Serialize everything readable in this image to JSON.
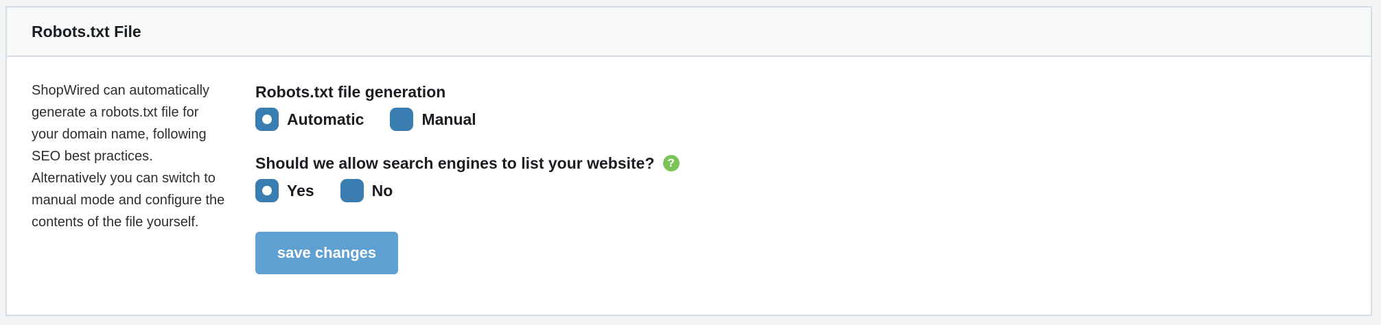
{
  "panel": {
    "title": "Robots.txt File",
    "description": "ShopWired can automatically generate a robots.txt file for your domain name, following SEO best practices. Alternatively you can switch to manual mode and configure the contents of the file yourself."
  },
  "generation": {
    "label": "Robots.txt file generation",
    "options": [
      {
        "label": "Automatic",
        "selected": true
      },
      {
        "label": "Manual",
        "selected": false
      }
    ]
  },
  "search_engines": {
    "label": "Should we allow search engines to list your website?",
    "help_icon": "question-mark-icon",
    "help_glyph": "?",
    "options": [
      {
        "label": "Yes",
        "selected": true
      },
      {
        "label": "No",
        "selected": false
      }
    ]
  },
  "actions": {
    "save_label": "save changes"
  },
  "colors": {
    "radio": "#3a7db1",
    "button": "#5fa0d3",
    "help": "#7dc458",
    "header_bg": "#f7f8f8",
    "border": "#d6dce3"
  }
}
